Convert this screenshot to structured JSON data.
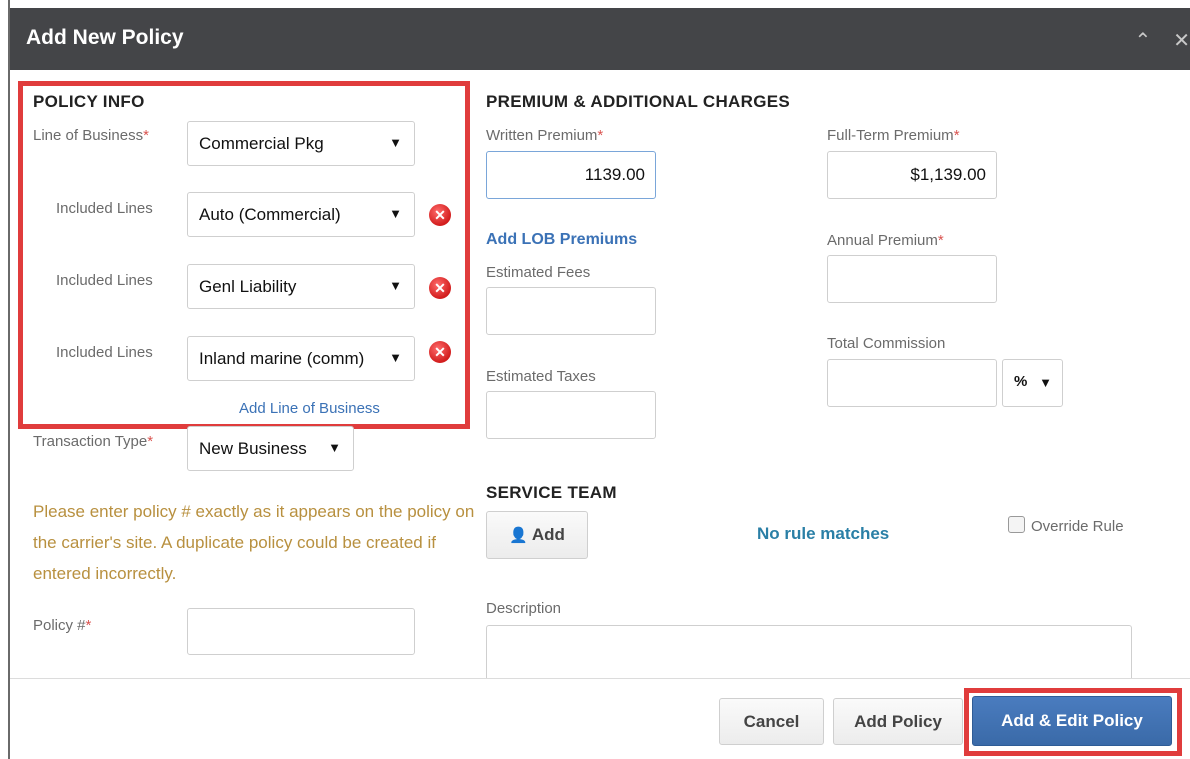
{
  "dialog": {
    "title": "Add New Policy"
  },
  "policy_info": {
    "heading": "POLICY INFO",
    "line_of_business_label": "Line of Business",
    "line_of_business_value": "Commercial Pkg",
    "included_lines_label": "Included Lines",
    "included_lines": [
      "Auto (Commercial)",
      "Genl Liability",
      "Inland marine (comm)"
    ],
    "add_line_link": "Add Line of Business",
    "transaction_type_label": "Transaction Type",
    "transaction_type_value": "New Business",
    "warning": "Please enter policy # exactly as it appears on the policy on the carrier's site. A duplicate policy could be created if entered incorrectly.",
    "policy_number_label": "Policy #",
    "policy_number_value": ""
  },
  "premium": {
    "heading": "PREMIUM & ADDITIONAL CHARGES",
    "written_premium_label": "Written Premium",
    "written_premium_value": "1139.00",
    "full_term_premium_label": "Full-Term Premium",
    "full_term_premium_value": "$1,139.00",
    "add_lob_link": "Add LOB Premiums",
    "annual_premium_label": "Annual Premium",
    "estimated_fees_label": "Estimated Fees",
    "total_commission_label": "Total Commission",
    "commission_unit": "%",
    "estimated_taxes_label": "Estimated Taxes"
  },
  "service_team": {
    "heading": "SERVICE TEAM",
    "add_button": "Add",
    "no_rule": "No rule matches",
    "override_label": "Override Rule",
    "description_label": "Description"
  },
  "footer": {
    "cancel": "Cancel",
    "add_policy": "Add Policy",
    "add_edit_policy": "Add & Edit Policy"
  },
  "colors": {
    "titlebar": "#444548",
    "highlight": "#e03c3c",
    "primary": "#3d70b3",
    "warning": "#b8903f",
    "link": "#3b72b6",
    "no_rule": "#2a7fa6"
  },
  "icons": {
    "minimize": "chevron-up-icon",
    "close": "close-icon",
    "remove": "remove-circle-icon",
    "user": "user-icon"
  }
}
